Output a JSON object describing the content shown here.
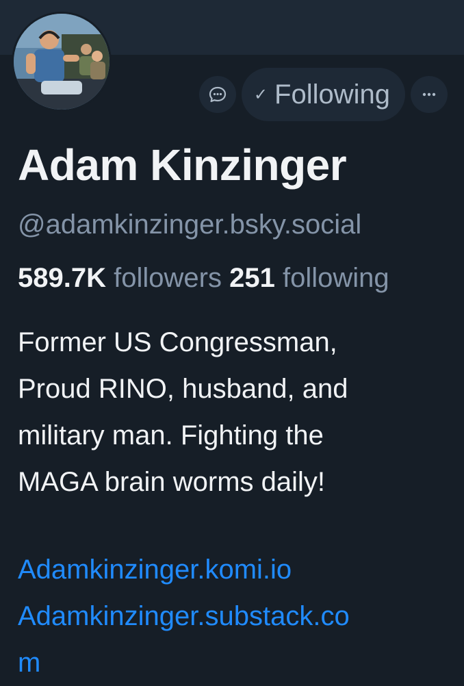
{
  "profile": {
    "name": "Adam Kinzinger",
    "handle": "@adamkinzinger.bsky.social",
    "followers_count": "589.7K",
    "followers_label": "followers",
    "following_count": "251",
    "following_label": "following",
    "bio_lines": [
      "Former US Congressman,",
      "Proud RINO, husband, and",
      "military man.  Fighting the",
      "MAGA brain worms daily!"
    ],
    "link_lines": [
      "Adamkinzinger.komi.io",
      "Adamkinzinger.substack.co",
      "m"
    ]
  },
  "actions": {
    "message_icon": "chat-bubble-icon",
    "follow_check": "✓",
    "follow_label": "Following",
    "more_icon": "ellipsis-icon"
  },
  "colors": {
    "background": "#161e27",
    "banner": "#1e2936",
    "button_bg": "#1e2936",
    "muted_text": "#8494a8",
    "link": "#208bfe",
    "primary_text": "#f1f3f5"
  }
}
